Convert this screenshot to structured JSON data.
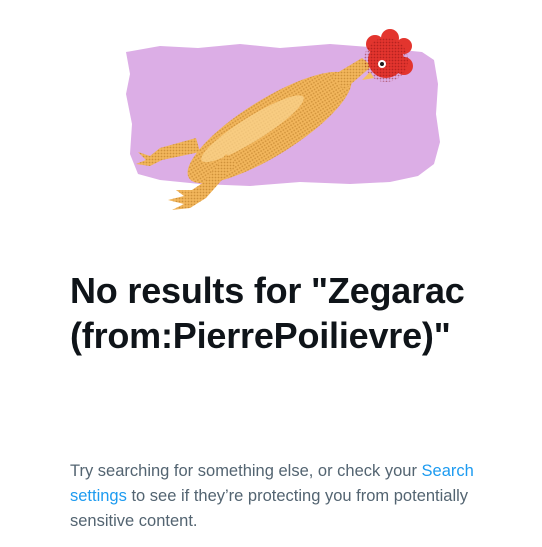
{
  "empty_state": {
    "illustration": {
      "subject": "rubber-chicken-illustration",
      "background_color": "#dcaee6"
    },
    "headline": "No results for \"Zegarac (from:PierrePoilievre)\"",
    "message_before_link": "Try searching for something else, or check your ",
    "link_label": "Search settings",
    "message_after_link": " to see if they’re protecting you from potentially sensitive content."
  },
  "colors": {
    "headline": "#0f1419",
    "body_text": "#536471",
    "link": "#1d9bf0"
  }
}
